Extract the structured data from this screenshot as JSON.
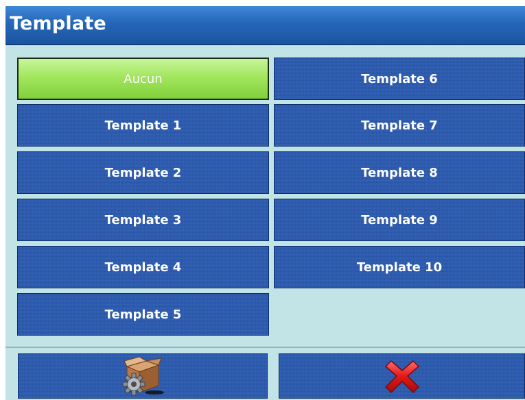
{
  "window": {
    "title": "Template"
  },
  "options": {
    "none": "Aucun",
    "t1": "Template 1",
    "t2": "Template 2",
    "t3": "Template 3",
    "t4": "Template 4",
    "t5": "Template 5",
    "t6": "Template 6",
    "t7": "Template 7",
    "t8": "Template 8",
    "t9": "Template 9",
    "t10": "Template 10"
  },
  "selected": "Aucun",
  "footer": {
    "left_icon": "package-settings-icon",
    "right_icon": "close-x-icon"
  },
  "colors": {
    "title_bar": "#2566b8",
    "background": "#c2e4e6",
    "button": "#2a5ab0",
    "selected_button": "#9be04f",
    "cancel_x": "#e01818"
  }
}
